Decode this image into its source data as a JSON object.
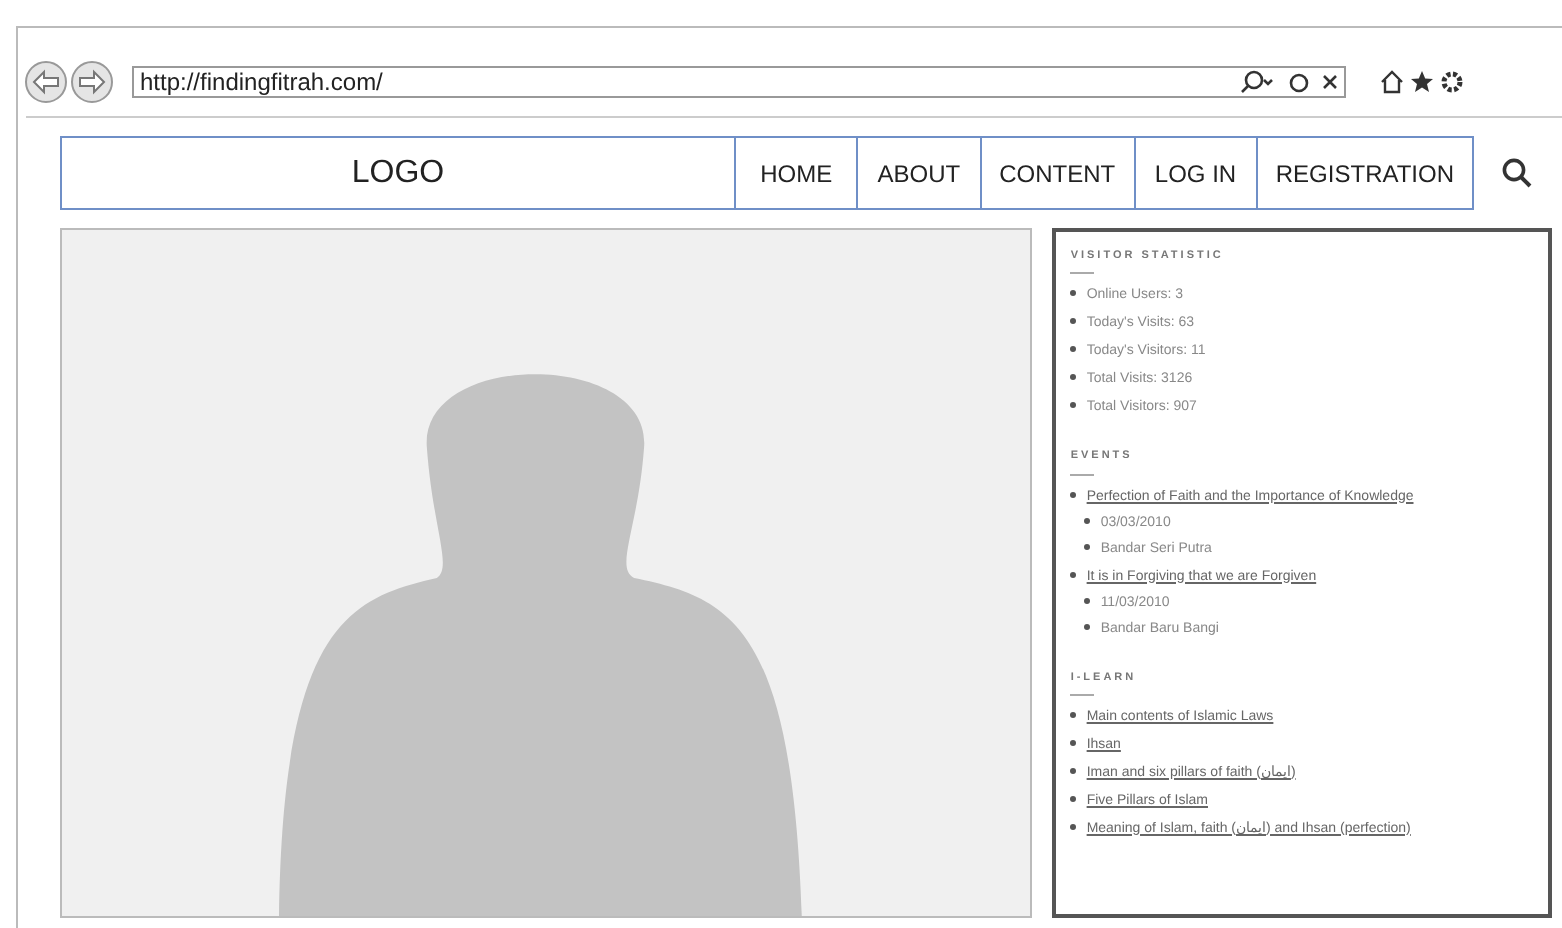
{
  "browser": {
    "url": "http://findingfitrah.com/"
  },
  "nav": {
    "logo": "LOGO",
    "items": [
      "HOME",
      "ABOUT",
      "CONTENT",
      "LOG IN",
      "REGISTRATION"
    ]
  },
  "sidebar": [
    {
      "kind": "list",
      "title": "VISITOR STATISTIC",
      "items": [
        {
          "text": "Online Users: 3"
        },
        {
          "text": "Today's Visits: 63"
        },
        {
          "text": "Today's Visitors: 11"
        },
        {
          "text": "Total Visits: 3126"
        },
        {
          "text": "Total Visitors: 907"
        }
      ]
    },
    {
      "kind": "links",
      "title": "EVENTS",
      "items": [
        {
          "text": "Perfection of Faith and the Importance of Knowledge",
          "children": [
            {
              "text": "03/03/2010"
            },
            {
              "text": "Bandar Seri Putra"
            }
          ]
        },
        {
          "text": "It is in Forgiving that we are Forgiven",
          "children": [
            {
              "text": "11/03/2010"
            },
            {
              "text": "Bandar Baru Bangi"
            }
          ]
        }
      ]
    },
    {
      "kind": "links",
      "title": "I-LEARN",
      "items": [
        {
          "text": "Main contents of Islamic Laws"
        },
        {
          "text": "Ihsan"
        },
        {
          "text": "Iman and six pillars of faith (ايمان)"
        },
        {
          "text": "Five Pillars of Islam"
        },
        {
          "text": "Meaning of Islam, faith (ايمان) and Ihsan (perfection)"
        }
      ]
    }
  ]
}
